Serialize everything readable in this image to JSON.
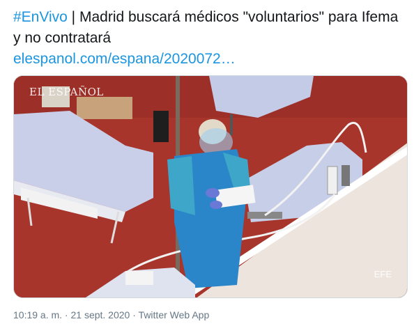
{
  "tweet": {
    "hashtag": "#EnVivo",
    "separator": " | ",
    "text_line": "Madrid buscará médicos \"voluntarios\" para Ifema y no contratará",
    "link": "elespanol.com/espana/2020072…"
  },
  "media": {
    "watermark_top": "EL ESPAÑOL",
    "watermark_bottom": "EFE"
  },
  "meta": {
    "timestamp": "10:19 a. m. · 21 sept. 2020",
    "separator": " · ",
    "source": "Twitter Web App"
  },
  "colors": {
    "link": "#1b95e0",
    "meta": "#657786",
    "floor": "#a8352c",
    "ppe_blue": "#2a86c9",
    "sheet": "#c7cee8"
  }
}
